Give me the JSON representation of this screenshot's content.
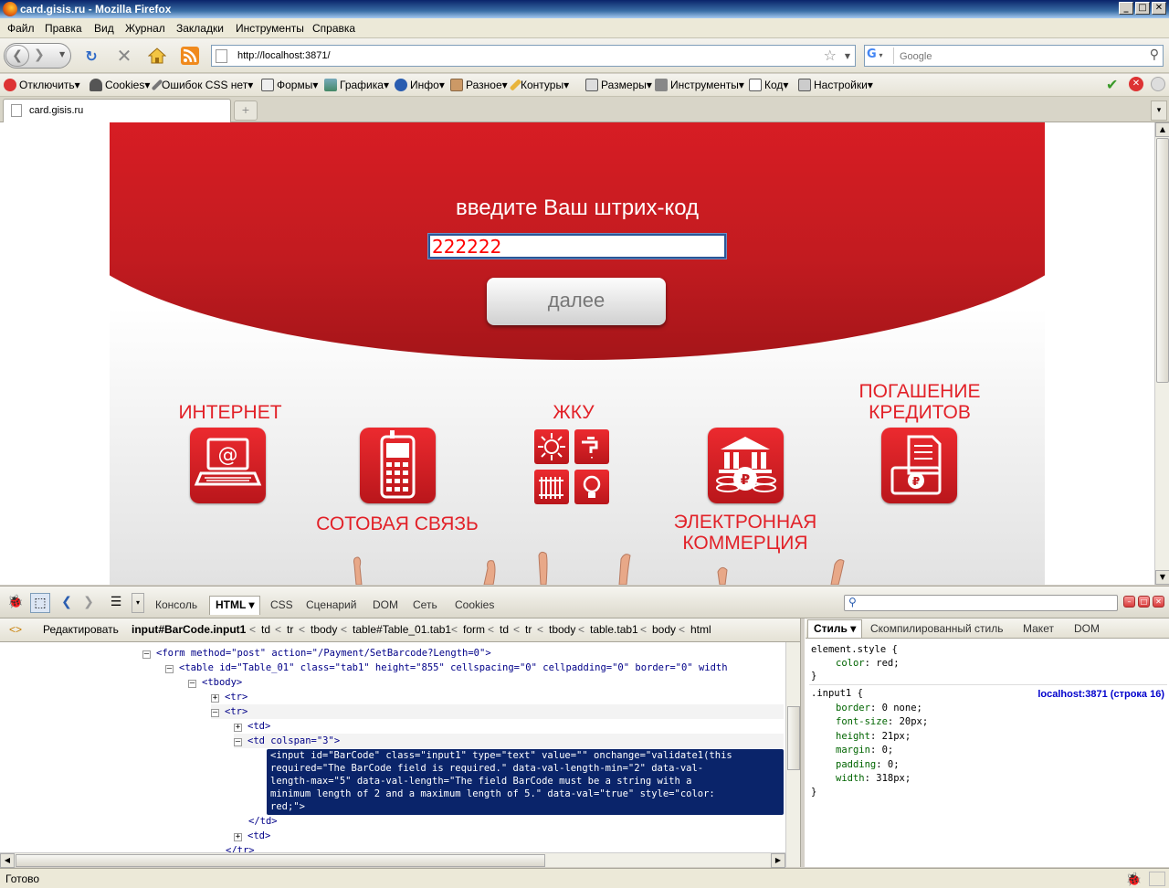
{
  "window": {
    "title": "card.gisis.ru - Mozilla Firefox",
    "controls": {
      "minimize": "_",
      "maximize": "□",
      "close": "✕"
    }
  },
  "menu": [
    "Файл",
    "Правка",
    "Вид",
    "Журнал",
    "Закладки",
    "Инструменты",
    "Справка"
  ],
  "nav": {
    "url": "http://localhost:3871/",
    "search_placeholder": "Google"
  },
  "webdev_toolbar": [
    "Отключить",
    "Cookies",
    "Ошибок CSS нет",
    "Формы",
    "Графика",
    "Инфо",
    "Разное",
    "Контуры",
    "Размеры",
    "Инструменты",
    "Код",
    "Настройки"
  ],
  "tabs": [
    {
      "label": "card.gisis.ru"
    }
  ],
  "page": {
    "headline": "введите Ваш штрих-код",
    "barcode_value": "222222",
    "next_button": "далее",
    "services": {
      "internet": "ИНТЕРНЕТ",
      "mobile": "СОТОВАЯ СВЯЗЬ",
      "utilities": "ЖКУ",
      "ecommerce_line1": "ЭЛЕКТРОННАЯ",
      "ecommerce_line2": "КОММЕРЦИЯ",
      "credit_line1": "ПОГАШЕНИЕ",
      "credit_line2": "КРЕДИТОВ"
    },
    "colors": {
      "brand_red": "#e41e26",
      "service_red": "#e22128"
    }
  },
  "firebug": {
    "tabs": [
      "Консоль",
      "HTML",
      "CSS",
      "Сценарий",
      "DOM",
      "Сеть",
      "Cookies"
    ],
    "active_tab": "HTML",
    "edit_button": "Редактировать",
    "breadcrumbs": [
      "input#BarCode.input1",
      "td",
      "tr",
      "tbody",
      "table#Table_01.tab1",
      "form",
      "td",
      "tr",
      "tbody",
      "table.tab1",
      "body",
      "html"
    ],
    "html_lines": [
      "<form method=\"post\" action=\"/Payment/SetBarcode?Length=0\">",
      "<table id=\"Table_01\" class=\"tab1\" height=\"855\" cellspacing=\"0\" cellpadding=\"0\" border=\"0\" width",
      "<tbody>",
      "<tr>",
      "<tr>",
      "<td>",
      "<td colspan=\"3\">",
      "</td>",
      "<td>",
      "</tr>"
    ],
    "selected_lines": [
      "<input id=\"BarCode\" class=\"input1\" type=\"text\" value=\"\" onchange=\"validate1(this",
      "required=\"The BarCode field is required.\" data-val-length-min=\"2\" data-val-",
      "length-max=\"5\" data-val-length=\"The field BarCode must be a string with a",
      "minimum length of 2 and a maximum length of 5.\" data-val=\"true\" style=\"color:",
      "red;\">"
    ],
    "side_tabs": [
      "Стиль",
      "Скомпилированный стиль",
      "Макет",
      "DOM"
    ],
    "active_side_tab": "Стиль",
    "style_rules": [
      {
        "selector": "element.style {",
        "source": "",
        "props": [
          {
            "name": "color",
            "value": "red;"
          }
        ]
      },
      {
        "selector": ".input1 {",
        "source": "localhost:3871 (строка 16)",
        "props": [
          {
            "name": "border",
            "value": "0 none;"
          },
          {
            "name": "font-size",
            "value": "20px;"
          },
          {
            "name": "height",
            "value": "21px;"
          },
          {
            "name": "margin",
            "value": "0;"
          },
          {
            "name": "padding",
            "value": "0;"
          },
          {
            "name": "width",
            "value": "318px;"
          }
        ]
      }
    ],
    "closing_brace": "}"
  },
  "status": {
    "text": "Готово"
  }
}
